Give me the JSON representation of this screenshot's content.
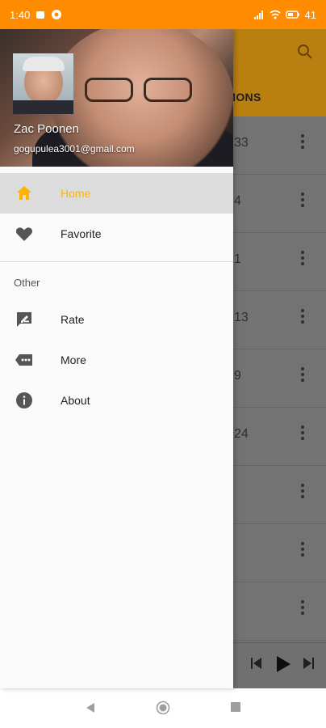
{
  "status_bar": {
    "time": "1:40",
    "battery": "41"
  },
  "background": {
    "tab_label": "RMONS",
    "row_numbers": [
      "33",
      "4",
      "1",
      "13",
      "9",
      "24",
      "",
      "",
      ""
    ]
  },
  "drawer": {
    "user_name": "Zac Poonen",
    "user_email": "gogupulea3001@gmail.com",
    "items": [
      {
        "label": "Home",
        "icon": "home-icon",
        "active": true
      },
      {
        "label": "Favorite",
        "icon": "heart-icon",
        "active": false
      }
    ],
    "section_title": "Other",
    "other_items": [
      {
        "label": "Rate",
        "icon": "rate-icon"
      },
      {
        "label": "More",
        "icon": "more-icon"
      },
      {
        "label": "About",
        "icon": "info-icon"
      }
    ]
  },
  "colors": {
    "status_bar": "#ff8c00",
    "accent": "#ffb300",
    "toolbar": "#c98a12"
  }
}
